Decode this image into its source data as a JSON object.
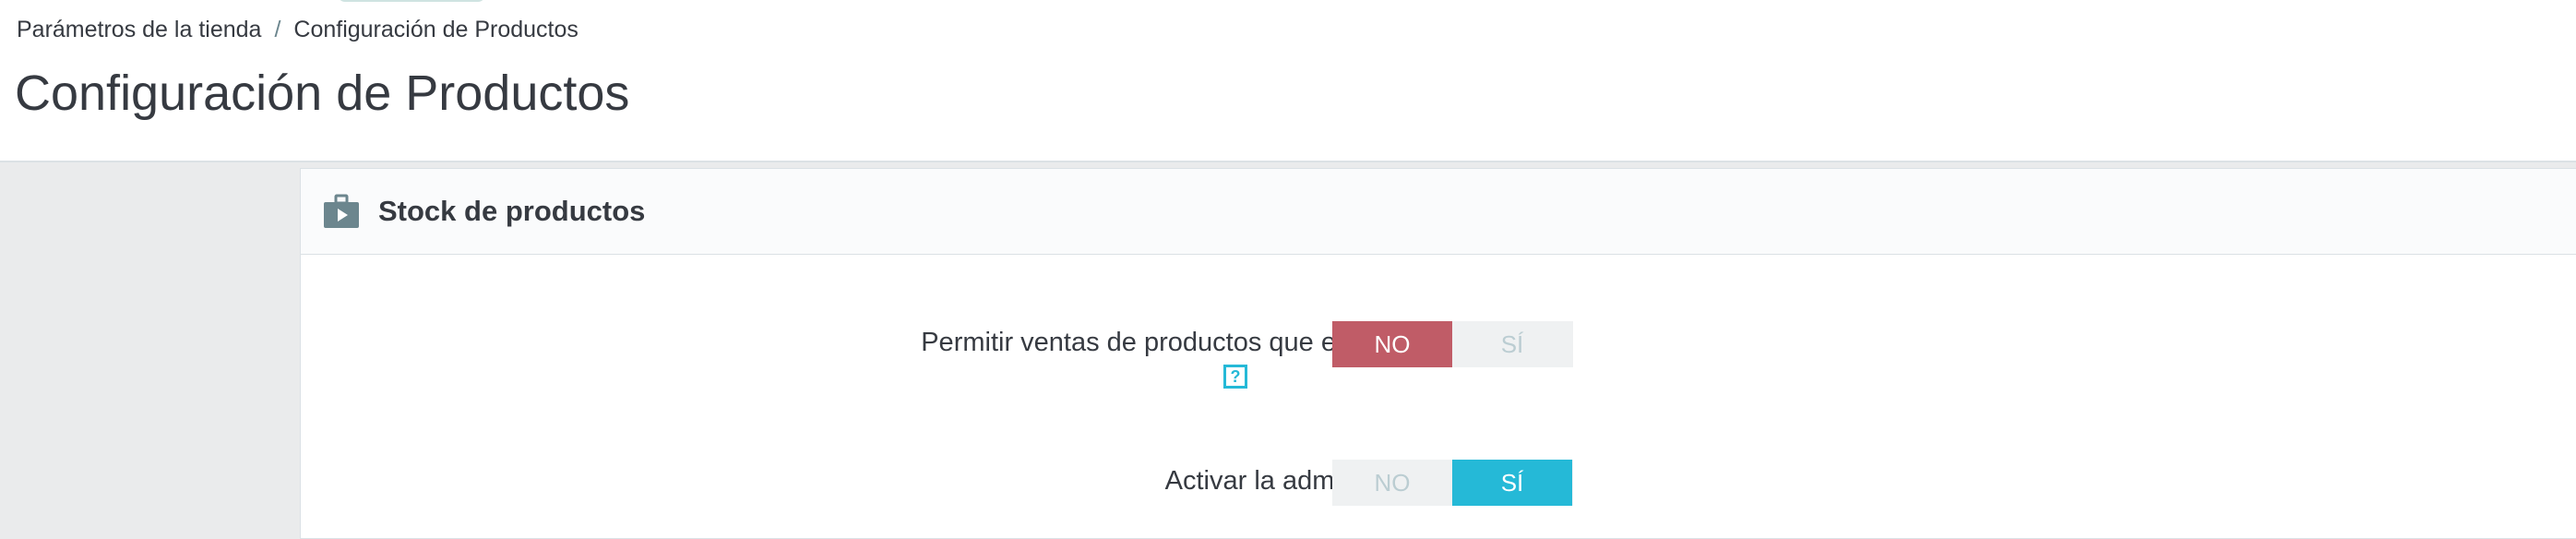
{
  "breadcrumb": {
    "items": [
      "Parámetros de la tienda",
      "Configuración de Productos"
    ],
    "separator": "/"
  },
  "page": {
    "title": "Configuración de Productos"
  },
  "panel": {
    "icon": "briefcase-icon",
    "title": "Stock de productos",
    "settings": [
      {
        "label": "Permitir ventas de productos que están fuera de stock",
        "help": "?",
        "no_label": "NO",
        "yes_label": "SÍ",
        "selected": "NO"
      },
      {
        "label": "Activar la administración de stock",
        "no_label": "NO",
        "yes_label": "SÍ",
        "selected": "SÍ"
      }
    ]
  },
  "colors": {
    "no_active": "#c05c67",
    "yes_active": "#25b9d7",
    "inactive_bg": "#eff1f2",
    "inactive_text": "#bbcdd2"
  }
}
